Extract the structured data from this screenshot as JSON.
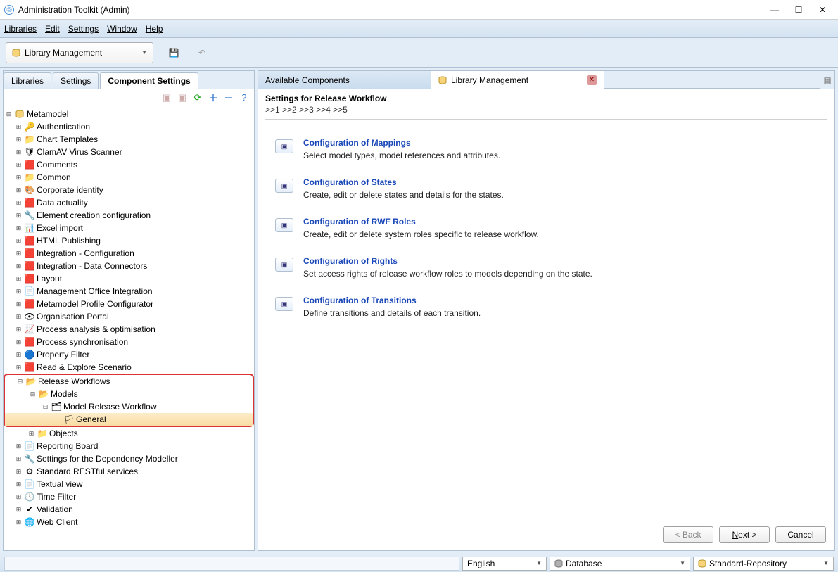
{
  "title": "Administration Toolkit (Admin)",
  "menu": [
    "Libraries",
    "Edit",
    "Settings",
    "Window",
    "Help"
  ],
  "toolbar_combo": "Library Management",
  "left_tabs": [
    "Libraries",
    "Settings",
    "Component Settings"
  ],
  "left_active_tab": 2,
  "right_tabs": [
    {
      "label": "Available Components",
      "active": false,
      "closable": false
    },
    {
      "label": "Library Management",
      "active": true,
      "closable": true
    }
  ],
  "panel_title": "Settings for Release Workflow",
  "breadcrumb": ">>1 >>2 >>3 >>4 >>5",
  "items": [
    {
      "title": "Configuration of Mappings",
      "desc": "Select model types, model references and attributes."
    },
    {
      "title": "Configuration of States",
      "desc": "Create, edit or delete states and details for the states."
    },
    {
      "title": "Configuration of RWF Roles",
      "desc": "Create, edit or delete system roles specific to release workflow."
    },
    {
      "title": "Configuration of Rights",
      "desc": "Set access rights of release workflow roles to models depending on the state."
    },
    {
      "title": "Configuration of Transitions",
      "desc": "Define transitions and details of each transition."
    }
  ],
  "buttons": {
    "back": "< Back",
    "next": "Next >",
    "cancel": "Cancel"
  },
  "status": {
    "lang": "English",
    "db": "Database",
    "repo": "Standard-Repository"
  },
  "tree_root": "Metamodel",
  "tree": [
    {
      "label": "Authentication",
      "i": "🔑"
    },
    {
      "label": "Chart Templates",
      "i": "📁"
    },
    {
      "label": "ClamAV Virus Scanner",
      "i": "🛡"
    },
    {
      "label": "Comments",
      "i": "🟥"
    },
    {
      "label": "Common",
      "i": "📁"
    },
    {
      "label": "Corporate identity",
      "i": "🎨"
    },
    {
      "label": "Data actuality",
      "i": "🟥"
    },
    {
      "label": "Element creation configuration",
      "i": "🔧"
    },
    {
      "label": "Excel import",
      "i": "📊"
    },
    {
      "label": "HTML Publishing",
      "i": "🟥"
    },
    {
      "label": "Integration - Configuration",
      "i": "🟥"
    },
    {
      "label": "Integration - Data Connectors",
      "i": "🟥"
    },
    {
      "label": "Layout",
      "i": "🟥"
    },
    {
      "label": "Management Office Integration",
      "i": "📄"
    },
    {
      "label": "Metamodel Profile Configurator",
      "i": "🟥"
    },
    {
      "label": "Organisation Portal",
      "i": "👁"
    },
    {
      "label": "Process analysis & optimisation",
      "i": "📈"
    },
    {
      "label": "Process synchronisation",
      "i": "🟥"
    },
    {
      "label": "Property Filter",
      "i": "🔵"
    },
    {
      "label": "Read & Explore Scenario",
      "i": "🟥"
    }
  ],
  "release_folder": "Release Workflows",
  "release_models": "Models",
  "release_mrw": "Model Release Workflow",
  "release_general": "General",
  "tree2": [
    {
      "label": "Objects",
      "i": "📁"
    },
    {
      "label": "Reporting Board",
      "i": "📄"
    },
    {
      "label": "Settings for the Dependency Modeller",
      "i": "🔧"
    },
    {
      "label": "Standard RESTful services",
      "i": "⚙"
    },
    {
      "label": "Textual view",
      "i": "📄"
    },
    {
      "label": "Time Filter",
      "i": "🕓"
    },
    {
      "label": "Validation",
      "i": "✔"
    },
    {
      "label": "Web Client",
      "i": "🌐"
    }
  ]
}
